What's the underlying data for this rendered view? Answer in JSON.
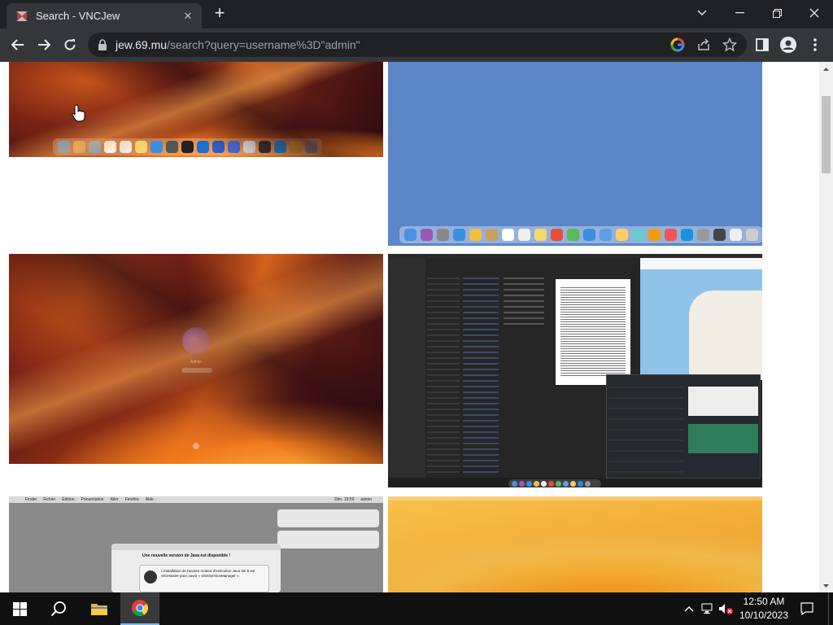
{
  "browser": {
    "tab_title": "Search - VNCJew",
    "tab_close_icon": "close-icon",
    "new_tab_icon": "plus-icon",
    "url_host": "jew.69.mu",
    "url_path": "/search?query=username%3D\"admin\"",
    "omnibox_icons": [
      "google-lens-icon",
      "share-icon",
      "bookmark-star-icon"
    ],
    "window_controls": [
      "chevron-down-icon",
      "minimize-icon",
      "restore-icon",
      "close-icon"
    ],
    "colors": {
      "chrome_dark": "#202124",
      "chrome_tab": "#35363a",
      "text": "#e8eaed"
    }
  },
  "results": {
    "screenshots": [
      {
        "wallpaper": "macOS Ventura orange",
        "dock_visible": true
      },
      {
        "wallpaper": "solid blue",
        "dock_visible": true
      },
      {
        "wallpaper": "macOS Ventura orange login",
        "login_user": "Admin"
      },
      {
        "wallpaper": "macOS dark desktop with Finder and map windows"
      },
      {
        "wallpaper": "macOS Finder with Java dialog",
        "menu_items": [
          "Finder",
          "Fichier",
          "Édition",
          "Présentation",
          "Aller",
          "Fenêtre",
          "Aide"
        ],
        "menu_clock": "Dim. 19:59",
        "menu_user": "admin",
        "dialog_title": "Une nouvelle version de Java est disponible !",
        "dialog_body": "L'installation de l'ancien moteur d'exécution Java SE 6 est nécessaire pour ouvrir « OSXServiceManager »."
      },
      {
        "wallpaper": "macOS Ventura yellow"
      }
    ]
  },
  "taskbar": {
    "time": "12:50 AM",
    "date": "10/10/2023",
    "apps": [
      "windows-start-icon",
      "search-icon",
      "file-explorer-icon",
      "chrome-icon"
    ],
    "tray": [
      "chevron-up-icon",
      "network-icon",
      "volume-muted-icon",
      "notifications-icon"
    ]
  }
}
